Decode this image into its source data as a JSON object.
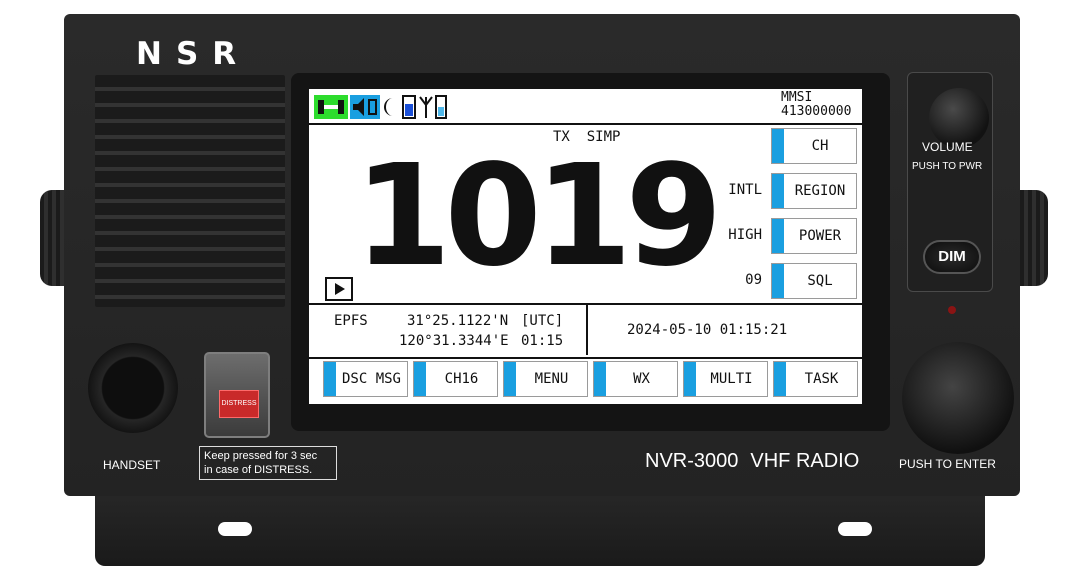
{
  "hardware": {
    "brand": "NSR",
    "handset_label": "HANDSET",
    "distress_button_label": "DISTRESS",
    "distress_note": [
      "Keep pressed for 3 sec",
      "in case of DISTRESS."
    ],
    "model": "NVR-3000",
    "product": "VHF RADIO",
    "volume_label": "VOLUME",
    "push_to_pwr": "PUSH TO PWR",
    "dim_label": "DIM",
    "push_to_enter": "PUSH TO ENTER"
  },
  "screen": {
    "status_icons": [
      "connector-icon",
      "speaker-icon",
      "moon-icon",
      "battery-icon",
      "antenna-icon",
      "signal-level-icon"
    ],
    "mmsi_label": "MMSI",
    "mmsi_value": "413000000",
    "mode": "TX  SIMP",
    "channel": "1019",
    "side_values": [
      "INTL",
      "HIGH",
      "09"
    ],
    "side_buttons": [
      "CH",
      "REGION",
      "POWER",
      "SQL"
    ],
    "position": {
      "source": "EPFS",
      "lat": "31°25.1122'N",
      "lon": "120°31.3344'E",
      "time_label": "[UTC]",
      "time": "01:15"
    },
    "datetime": "2024-05-10 01:15:21",
    "bottom_buttons": [
      "DSC MSG",
      "CH16",
      "MENU",
      "WX",
      "MULTI",
      "TASK"
    ]
  },
  "colors": {
    "accent_blue": "#1a9fe0",
    "connector_green": "#2ddc2d",
    "distress_red": "#c92a2a"
  }
}
